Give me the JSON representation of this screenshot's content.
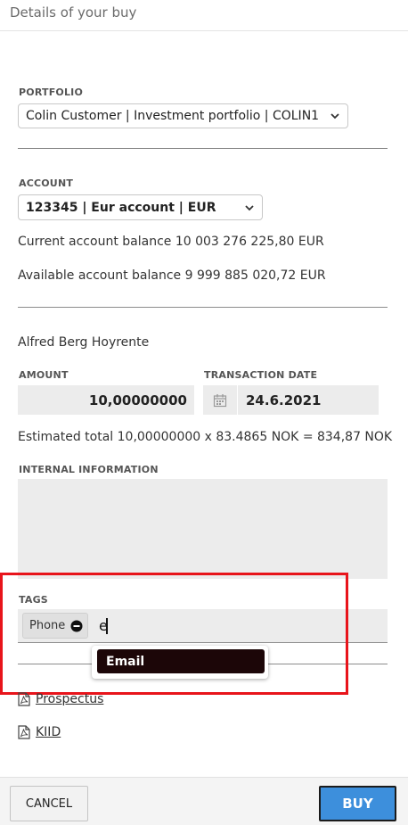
{
  "header": {
    "title": "Details of your buy"
  },
  "portfolio": {
    "label": "PORTFOLIO",
    "selected": "Colin Customer | Investment portfolio | COLIN1"
  },
  "account": {
    "label": "ACCOUNT",
    "selected": "123345 | Eur account | EUR",
    "current_balance": "Current account balance 10 003 276 225,80 EUR",
    "available_balance": "Available account balance 9 999 885 020,72 EUR"
  },
  "instrument": {
    "name": "Alfred Berg Hoyrente"
  },
  "amount": {
    "label": "AMOUNT",
    "value": "10,00000000"
  },
  "transaction_date": {
    "label": "TRANSACTION DATE",
    "value": "24.6.2021"
  },
  "estimated_total": "Estimated total 10,00000000 x 83.4865 NOK = 834,87 NOK",
  "internal_information": {
    "label": "INTERNAL INFORMATION",
    "value": ""
  },
  "tags": {
    "label": "TAGS",
    "chips": [
      "Phone"
    ],
    "input_value": "e",
    "suggestions": [
      "Email"
    ]
  },
  "documents": [
    "Prospectus",
    "KIID"
  ],
  "footer": {
    "cancel_label": "CANCEL",
    "buy_label": "BUY"
  },
  "colors": {
    "highlight_box": "#e8141b",
    "buy_button": "#3d8fdc",
    "suggestion_bg": "#1c0608"
  }
}
